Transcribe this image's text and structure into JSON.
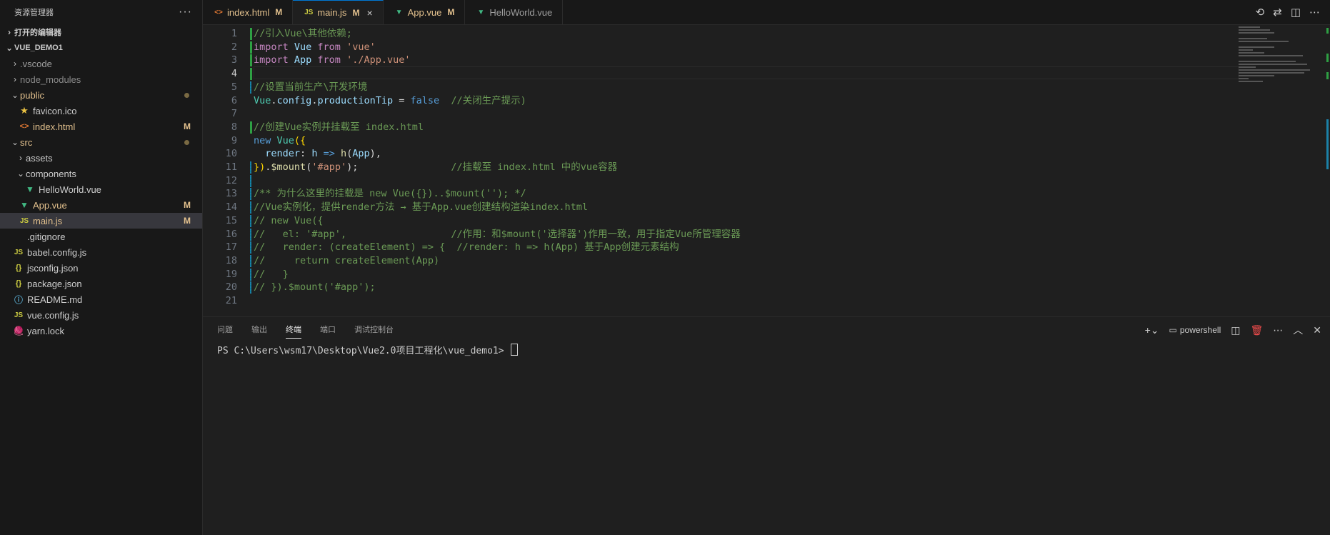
{
  "sidebar": {
    "title": "资源管理器",
    "more": "···",
    "open_editors": "打开的编辑器",
    "project": "VUE_DEMO1",
    "items": [
      {
        "label": ".vscode",
        "indent": 1,
        "kind": "folder",
        "open": false,
        "color": "#9d9d9d"
      },
      {
        "label": "node_modules",
        "indent": 1,
        "kind": "folder",
        "open": false,
        "color": "#8b8b8b"
      },
      {
        "label": "public",
        "indent": 1,
        "kind": "folder",
        "open": true,
        "color": "#e2c08d",
        "dot": true
      },
      {
        "label": "favicon.ico",
        "indent": 2,
        "kind": "star",
        "color": "#cccccc"
      },
      {
        "label": "index.html",
        "indent": 2,
        "kind": "html",
        "color": "#e2c08d",
        "badge": "M"
      },
      {
        "label": "src",
        "indent": 1,
        "kind": "folder",
        "open": true,
        "color": "#e2c08d",
        "dot": true
      },
      {
        "label": "assets",
        "indent": 2,
        "kind": "folder",
        "open": false,
        "color": "#cccccc"
      },
      {
        "label": "components",
        "indent": 2,
        "kind": "folder",
        "open": true,
        "color": "#cccccc"
      },
      {
        "label": "HelloWorld.vue",
        "indent": 3,
        "kind": "vue",
        "color": "#cccccc"
      },
      {
        "label": "App.vue",
        "indent": 2,
        "kind": "vue",
        "color": "#e2c08d",
        "badge": "M"
      },
      {
        "label": "main.js",
        "indent": 2,
        "kind": "js",
        "color": "#e2c08d",
        "badge": "M",
        "selected": true
      },
      {
        "label": ".gitignore",
        "indent": 1,
        "kind": "none",
        "color": "#cccccc"
      },
      {
        "label": "babel.config.js",
        "indent": 1,
        "kind": "js",
        "color": "#cccccc"
      },
      {
        "label": "jsconfig.json",
        "indent": 1,
        "kind": "json",
        "color": "#cccccc"
      },
      {
        "label": "package.json",
        "indent": 1,
        "kind": "json",
        "color": "#cccccc"
      },
      {
        "label": "README.md",
        "indent": 1,
        "kind": "info",
        "color": "#cccccc"
      },
      {
        "label": "vue.config.js",
        "indent": 1,
        "kind": "js",
        "color": "#cccccc"
      },
      {
        "label": "yarn.lock",
        "indent": 1,
        "kind": "yarn",
        "color": "#cccccc"
      }
    ]
  },
  "tabs": [
    {
      "label": "index.html",
      "icon": "html",
      "modified": "M",
      "active": false
    },
    {
      "label": "main.js",
      "icon": "js",
      "modified": "M",
      "active": true
    },
    {
      "label": "App.vue",
      "icon": "vue",
      "modified": "M",
      "active": false
    },
    {
      "label": "HelloWorld.vue",
      "icon": "vue",
      "modified": "",
      "active": false
    }
  ],
  "editor": {
    "current_line": 4,
    "lines": [
      {
        "n": 1,
        "gutter": "add",
        "tokens": [
          [
            "com",
            "//引入Vue\\其他依赖;"
          ]
        ]
      },
      {
        "n": 2,
        "gutter": "add",
        "tokens": [
          [
            "kw",
            "import "
          ],
          [
            "var",
            "Vue"
          ],
          [
            "kw",
            " from "
          ],
          [
            "str",
            "'vue'"
          ]
        ]
      },
      {
        "n": 3,
        "gutter": "add",
        "tokens": [
          [
            "kw",
            "import "
          ],
          [
            "var",
            "App"
          ],
          [
            "kw",
            " from "
          ],
          [
            "str",
            "'./App.vue'"
          ]
        ]
      },
      {
        "n": 4,
        "gutter": "add",
        "tokens": []
      },
      {
        "n": 5,
        "gutter": "mod",
        "tokens": [
          [
            "com",
            "//设置当前生产\\开发环境"
          ]
        ]
      },
      {
        "n": 6,
        "gutter": "",
        "tokens": [
          [
            "cls",
            "Vue"
          ],
          [
            "w",
            "."
          ],
          [
            "var",
            "config"
          ],
          [
            "w",
            "."
          ],
          [
            "var",
            "productionTip"
          ],
          [
            "w",
            " = "
          ],
          [
            "blue",
            "false"
          ],
          [
            "w",
            "  "
          ],
          [
            "com",
            "//关闭生产提示)"
          ]
        ]
      },
      {
        "n": 7,
        "gutter": "",
        "tokens": []
      },
      {
        "n": 8,
        "gutter": "add",
        "tokens": [
          [
            "com",
            "//创建Vue实例并挂载至 index.html"
          ]
        ]
      },
      {
        "n": 9,
        "gutter": "",
        "tokens": [
          [
            "blue",
            "new "
          ],
          [
            "cls",
            "Vue"
          ],
          [
            "p",
            "({"
          ]
        ]
      },
      {
        "n": 10,
        "gutter": "",
        "tokens": [
          [
            "w",
            "  "
          ],
          [
            "var",
            "render"
          ],
          [
            "w",
            ": "
          ],
          [
            "var",
            "h"
          ],
          [
            "blue",
            " =>"
          ],
          [
            "w",
            " "
          ],
          [
            "fn",
            "h"
          ],
          [
            "w",
            "("
          ],
          [
            "var",
            "App"
          ],
          [
            "w",
            "),"
          ]
        ]
      },
      {
        "n": 11,
        "gutter": "mod",
        "tokens": [
          [
            "p",
            "})"
          ],
          [
            "w",
            "."
          ],
          [
            "fn",
            "$mount"
          ],
          [
            "w",
            "("
          ],
          [
            "str",
            "'#app'"
          ],
          [
            "w",
            ");"
          ],
          [
            "w",
            "                "
          ],
          [
            "com",
            "//挂载至 index.html 中的vue容器"
          ]
        ]
      },
      {
        "n": 12,
        "gutter": "mod",
        "tokens": []
      },
      {
        "n": 13,
        "gutter": "mod",
        "tokens": [
          [
            "com",
            "/** 为什么这里的挂载是 new Vue({})..$mount(''); */"
          ]
        ]
      },
      {
        "n": 14,
        "gutter": "mod",
        "tokens": [
          [
            "com",
            "//Vue实例化，提供render方法 → 基于App.vue创建结构渲染index.html"
          ]
        ]
      },
      {
        "n": 15,
        "gutter": "mod",
        "tokens": [
          [
            "com",
            "// new Vue({"
          ]
        ]
      },
      {
        "n": 16,
        "gutter": "mod",
        "tokens": [
          [
            "com",
            "//   el: '#app',                  //作用：和$mount('选择器')作用一致，用于指定Vue所管理容器"
          ]
        ]
      },
      {
        "n": 17,
        "gutter": "mod",
        "tokens": [
          [
            "com",
            "//   render: (createElement) => {  //render: h => h(App) 基于App创建元素结构"
          ]
        ]
      },
      {
        "n": 18,
        "gutter": "mod",
        "tokens": [
          [
            "com",
            "//     return createElement(App)"
          ]
        ]
      },
      {
        "n": 19,
        "gutter": "mod",
        "tokens": [
          [
            "com",
            "//   }"
          ]
        ]
      },
      {
        "n": 20,
        "gutter": "mod",
        "tokens": [
          [
            "com",
            "// }).$mount('#app');"
          ]
        ]
      },
      {
        "n": 21,
        "gutter": "",
        "tokens": []
      }
    ]
  },
  "panel": {
    "tabs": [
      "问题",
      "输出",
      "终端",
      "端口",
      "调试控制台"
    ],
    "active_tab": 2,
    "shell": "powershell",
    "prompt": "PS C:\\Users\\wsm17\\Desktop\\Vue2.0项目工程化\\vue_demo1> "
  },
  "icons": {
    "timeline": "timeline-icon",
    "compare": "compare-icon",
    "split": "split-editor-icon",
    "more": "more-icon"
  },
  "colors": {
    "accent": "#0078d4",
    "modified": "#e2c08d",
    "added_gutter": "#2ea043",
    "modified_gutter": "#1b81a8"
  }
}
